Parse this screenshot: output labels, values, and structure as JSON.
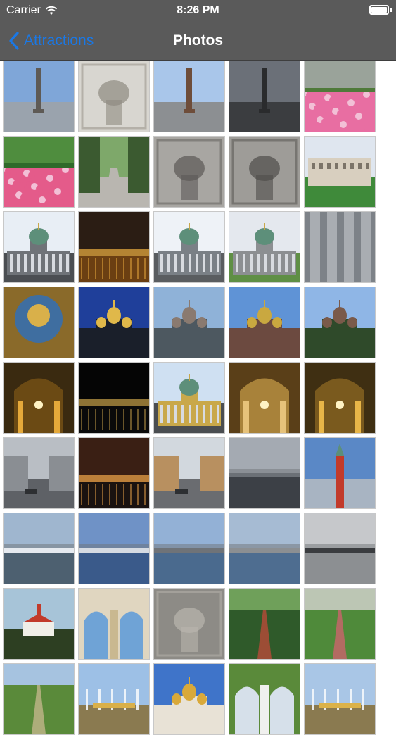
{
  "status_bar": {
    "carrier": "Carrier",
    "time": "8:26 PM",
    "battery": 1.0
  },
  "nav": {
    "back_label": "Attractions",
    "title": "Photos"
  },
  "photos": [
    {
      "name": "column-sky",
      "sky": "#7fa6d8",
      "ground": "#9aa3ad",
      "accent": "#5e5a55",
      "kind": "column"
    },
    {
      "name": "relief-stone",
      "sky": "#d8d6d0",
      "ground": "#b9b6ae",
      "accent": "#8f8a80",
      "kind": "relief"
    },
    {
      "name": "alexander-column",
      "sky": "#a9c6ea",
      "ground": "#8c8f92",
      "accent": "#6e4d3a",
      "kind": "column"
    },
    {
      "name": "dark-column",
      "sky": "#6b7078",
      "ground": "#3b3d40",
      "accent": "#2a2b2d",
      "kind": "column"
    },
    {
      "name": "flower-garden",
      "sky": "#9aa39a",
      "ground": "#e86ea2",
      "accent": "#4f7a3a",
      "kind": "flowers"
    },
    {
      "name": "tulips",
      "sky": "#4f8d3e",
      "ground": "#e45b8a",
      "accent": "#2f6a2a",
      "kind": "flowers"
    },
    {
      "name": "alley",
      "sky": "#7ea86a",
      "ground": "#b9b6b0",
      "accent": "#3b5a30",
      "kind": "alley"
    },
    {
      "name": "skeleton-relief",
      "sky": "#a8a6a2",
      "ground": "#8e8c88",
      "accent": "#5b5956",
      "kind": "relief"
    },
    {
      "name": "skull-relief",
      "sky": "#9e9c98",
      "ground": "#7f7d79",
      "accent": "#4f4d4a",
      "kind": "relief"
    },
    {
      "name": "palace-lawn",
      "sky": "#dfe6ef",
      "ground": "#3f8a3a",
      "accent": "#d8cfbf",
      "kind": "building"
    },
    {
      "name": "kazan-colonnade",
      "sky": "#e8eef5",
      "ground": "#4b4e52",
      "accent": "#6f7378",
      "kind": "dome"
    },
    {
      "name": "night-embankment",
      "sky": "#2b1d14",
      "ground": "#6b3f12",
      "accent": "#f0b040",
      "kind": "night"
    },
    {
      "name": "kazan-dome",
      "sky": "#eef2f7",
      "ground": "#5a5d60",
      "accent": "#7a8086",
      "kind": "dome"
    },
    {
      "name": "kazan-front",
      "sky": "#e4e8ee",
      "ground": "#5f8f45",
      "accent": "#8c8f92",
      "kind": "dome"
    },
    {
      "name": "columns-closeup",
      "sky": "#7d8288",
      "ground": "#5b6066",
      "accent": "#a9adb2",
      "kind": "columns"
    },
    {
      "name": "ceiling-fresco",
      "sky": "#8a6a2a",
      "ground": "#3f6ea0",
      "accent": "#d9b04a",
      "kind": "fresco"
    },
    {
      "name": "spilled-blood-night",
      "sky": "#1f3f9a",
      "ground": "#1a1f2a",
      "accent": "#e0b84a",
      "kind": "church"
    },
    {
      "name": "canal-church",
      "sky": "#8fb2d8",
      "ground": "#4d5860",
      "accent": "#8a7a70",
      "kind": "church"
    },
    {
      "name": "spilled-blood-day",
      "sky": "#5f93d6",
      "ground": "#6c4a40",
      "accent": "#c9a840",
      "kind": "church"
    },
    {
      "name": "spilled-blood-trees",
      "sky": "#8fb6e6",
      "ground": "#2f4a2a",
      "accent": "#7a5a4a",
      "kind": "church"
    },
    {
      "name": "golden-interior",
      "sky": "#6b4a14",
      "ground": "#3a2a10",
      "accent": "#e5a93a",
      "kind": "interior"
    },
    {
      "name": "fountain-night",
      "sky": "#050505",
      "ground": "#0a0a0a",
      "accent": "#c9a24a",
      "kind": "night"
    },
    {
      "name": "isaac-cathedral",
      "sky": "#cfe0f2",
      "ground": "#4a4d50",
      "accent": "#c9a84a",
      "kind": "dome"
    },
    {
      "name": "isaac-interior",
      "sky": "#a8823a",
      "ground": "#5a3f18",
      "accent": "#e6c27a",
      "kind": "interior"
    },
    {
      "name": "gilded-hall",
      "sky": "#7a5a1e",
      "ground": "#3f2f12",
      "accent": "#e8b648",
      "kind": "interior"
    },
    {
      "name": "street-cars",
      "sky": "#b9bec4",
      "ground": "#5e6166",
      "accent": "#8a8e93",
      "kind": "street"
    },
    {
      "name": "nevsky-night",
      "sky": "#3a1f14",
      "ground": "#1a1210",
      "accent": "#f2a84a",
      "kind": "night"
    },
    {
      "name": "nevsky-day",
      "sky": "#d2d8de",
      "ground": "#6a6c70",
      "accent": "#b89060",
      "kind": "street"
    },
    {
      "name": "river-cloudy",
      "sky": "#a4aab2",
      "ground": "#3c4046",
      "accent": "#6b7076",
      "kind": "river"
    },
    {
      "name": "duma-tower",
      "sky": "#5a88c6",
      "ground": "#a8b4c2",
      "accent": "#c23a2a",
      "kind": "tower"
    },
    {
      "name": "cruise-ship",
      "sky": "#9fb6cf",
      "ground": "#4d6070",
      "accent": "#e6eaef",
      "kind": "river"
    },
    {
      "name": "neva-blue",
      "sky": "#6f92c6",
      "ground": "#3a5a8a",
      "accent": "#d6dbe2",
      "kind": "river"
    },
    {
      "name": "bridge-neva",
      "sky": "#93b1d6",
      "ground": "#4a6a8e",
      "accent": "#6f7378",
      "kind": "river"
    },
    {
      "name": "embankment-river",
      "sky": "#a6bbd3",
      "ground": "#4e6d90",
      "accent": "#8c8f92",
      "kind": "river"
    },
    {
      "name": "grey-river",
      "sky": "#c6c8cb",
      "ground": "#8c8f92",
      "accent": "#3a3c3f",
      "kind": "river"
    },
    {
      "name": "red-castle",
      "sky": "#a7c4d8",
      "ground": "#2d3f22",
      "accent": "#c23a2a",
      "kind": "castle"
    },
    {
      "name": "rotunda-arches",
      "sky": "#6fa3d6",
      "ground": "#e0d6c0",
      "accent": "#c9b890",
      "kind": "arches"
    },
    {
      "name": "battle-relief",
      "sky": "#8d8b86",
      "ground": "#6d6b66",
      "accent": "#b9b6ae",
      "kind": "relief"
    },
    {
      "name": "park-pond",
      "sky": "#6fa05a",
      "ground": "#2f5a2a",
      "accent": "#c24a3a",
      "kind": "park"
    },
    {
      "name": "flower-path",
      "sky": "#bcc6b4",
      "ground": "#4f8a3a",
      "accent": "#d46070",
      "kind": "park"
    },
    {
      "name": "peterhof-lawn",
      "sky": "#a6c3e0",
      "ground": "#5a8a3a",
      "accent": "#c9b890",
      "kind": "park"
    },
    {
      "name": "peterhof-fountain",
      "sky": "#9dc0e6",
      "ground": "#8a7a50",
      "accent": "#d9b04a",
      "kind": "fountain"
    },
    {
      "name": "golden-domes",
      "sky": "#3f74c9",
      "ground": "#e8e2d6",
      "accent": "#d9a93a",
      "kind": "church"
    },
    {
      "name": "white-pavilion",
      "sky": "#d6e0ea",
      "ground": "#5a8a3a",
      "accent": "#f0f0ee",
      "kind": "arches"
    },
    {
      "name": "samson-fountain",
      "sky": "#a9c6e6",
      "ground": "#8a7a50",
      "accent": "#dbb24a",
      "kind": "fountain"
    }
  ]
}
